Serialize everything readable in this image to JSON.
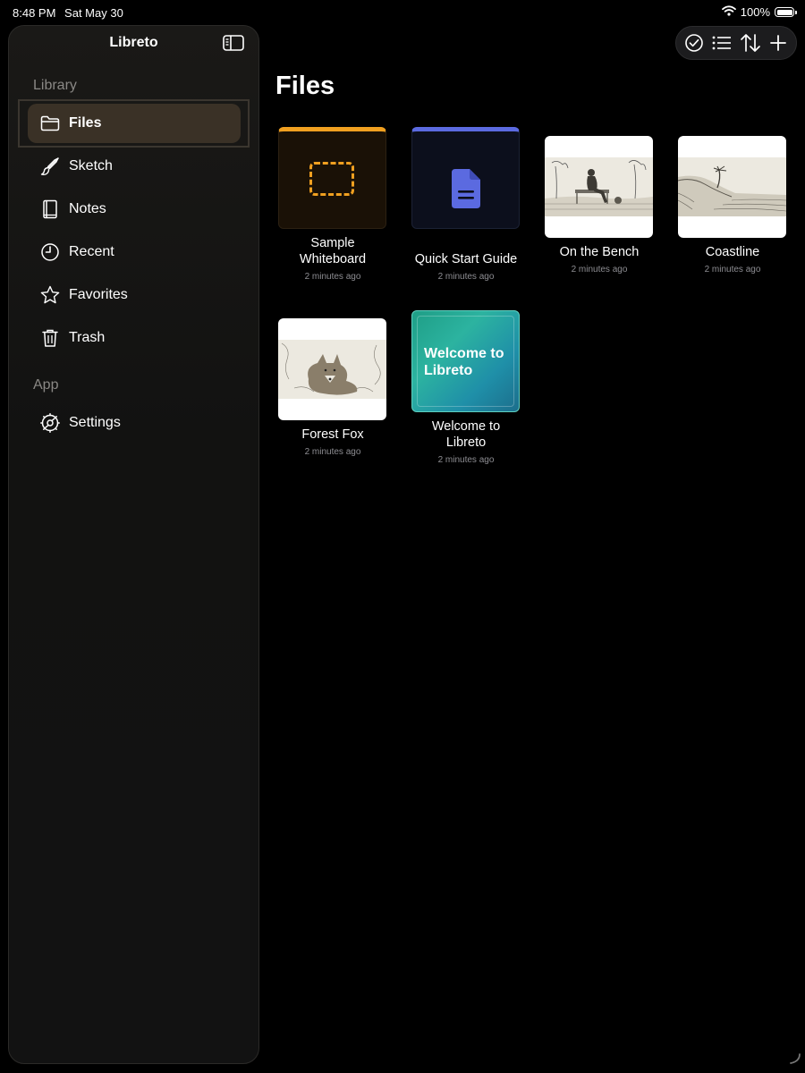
{
  "status": {
    "time": "8:48 PM",
    "date": "Sat May 30",
    "battery": "100%"
  },
  "sidebar": {
    "title": "Libreto",
    "sections": [
      {
        "header": "Library",
        "items": [
          {
            "label": "Files",
            "icon": "folder-icon",
            "active": true
          },
          {
            "label": "Sketch",
            "icon": "brush-icon"
          },
          {
            "label": "Notes",
            "icon": "book-icon"
          },
          {
            "label": "Recent",
            "icon": "clock-icon"
          },
          {
            "label": "Favorites",
            "icon": "star-icon"
          },
          {
            "label": "Trash",
            "icon": "trash-icon"
          }
        ]
      },
      {
        "header": "App",
        "items": [
          {
            "label": "Settings",
            "icon": "gear-icon"
          }
        ]
      }
    ]
  },
  "toolbar": {
    "icons": [
      "checkmark-circle-icon",
      "list-icon",
      "sort-arrows-icon",
      "plus-icon"
    ]
  },
  "page": {
    "title": "Files"
  },
  "files": [
    {
      "name": "Sample Whiteboard",
      "time": "2 minutes ago",
      "kind": "whiteboard",
      "accent": "#f0a020"
    },
    {
      "name": "Quick Start Guide",
      "time": "2 minutes ago",
      "kind": "document",
      "accent": "#5b6ae0"
    },
    {
      "name": "On the Bench",
      "time": "2 minutes ago",
      "kind": "sketch"
    },
    {
      "name": "Coastline",
      "time": "2 minutes ago",
      "kind": "sketch"
    },
    {
      "name": "Forest Fox",
      "time": "2 minutes ago",
      "kind": "sketch"
    },
    {
      "name": "Welcome to Libreto",
      "time": "2 minutes ago",
      "kind": "notebook",
      "cover_text": "Welcome to Libreto"
    }
  ]
}
